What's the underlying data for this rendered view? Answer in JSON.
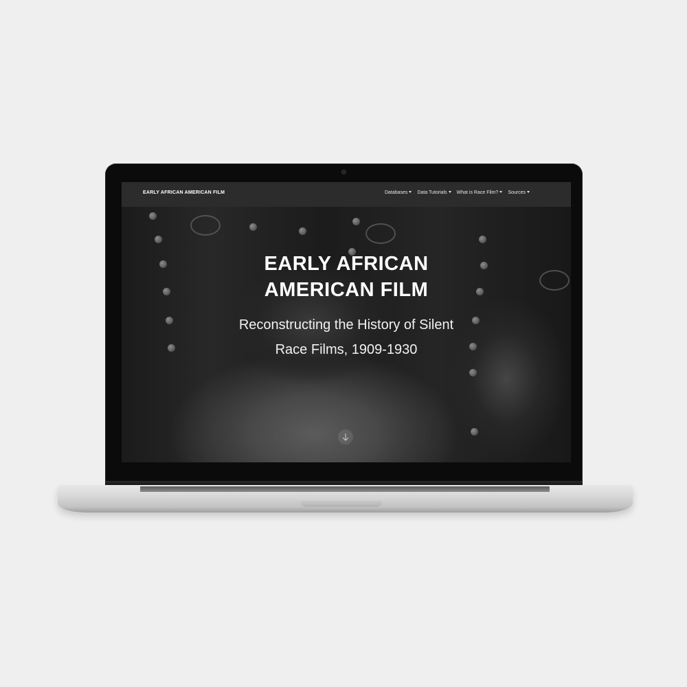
{
  "navbar": {
    "brand": "EARLY AFRICAN AMERICAN FILM",
    "items": [
      {
        "label": "Databases",
        "has_dropdown": true
      },
      {
        "label": "Data Tutorials",
        "has_dropdown": true
      },
      {
        "label": "What is Race Film?",
        "has_dropdown": true
      },
      {
        "label": "Sources",
        "has_dropdown": true
      }
    ]
  },
  "hero": {
    "title_line1": "EARLY AFRICAN",
    "title_line2": "AMERICAN FILM",
    "subtitle_line1": "Reconstructing the History of Silent",
    "subtitle_line2": "Race Films, 1909-1930",
    "scroll_icon": "arrow-down-icon",
    "background_image": "black-and-white film still"
  },
  "colors": {
    "navbar_bg": "#2c2c2c",
    "text": "#ffffff",
    "page_bg": "#efefef"
  }
}
